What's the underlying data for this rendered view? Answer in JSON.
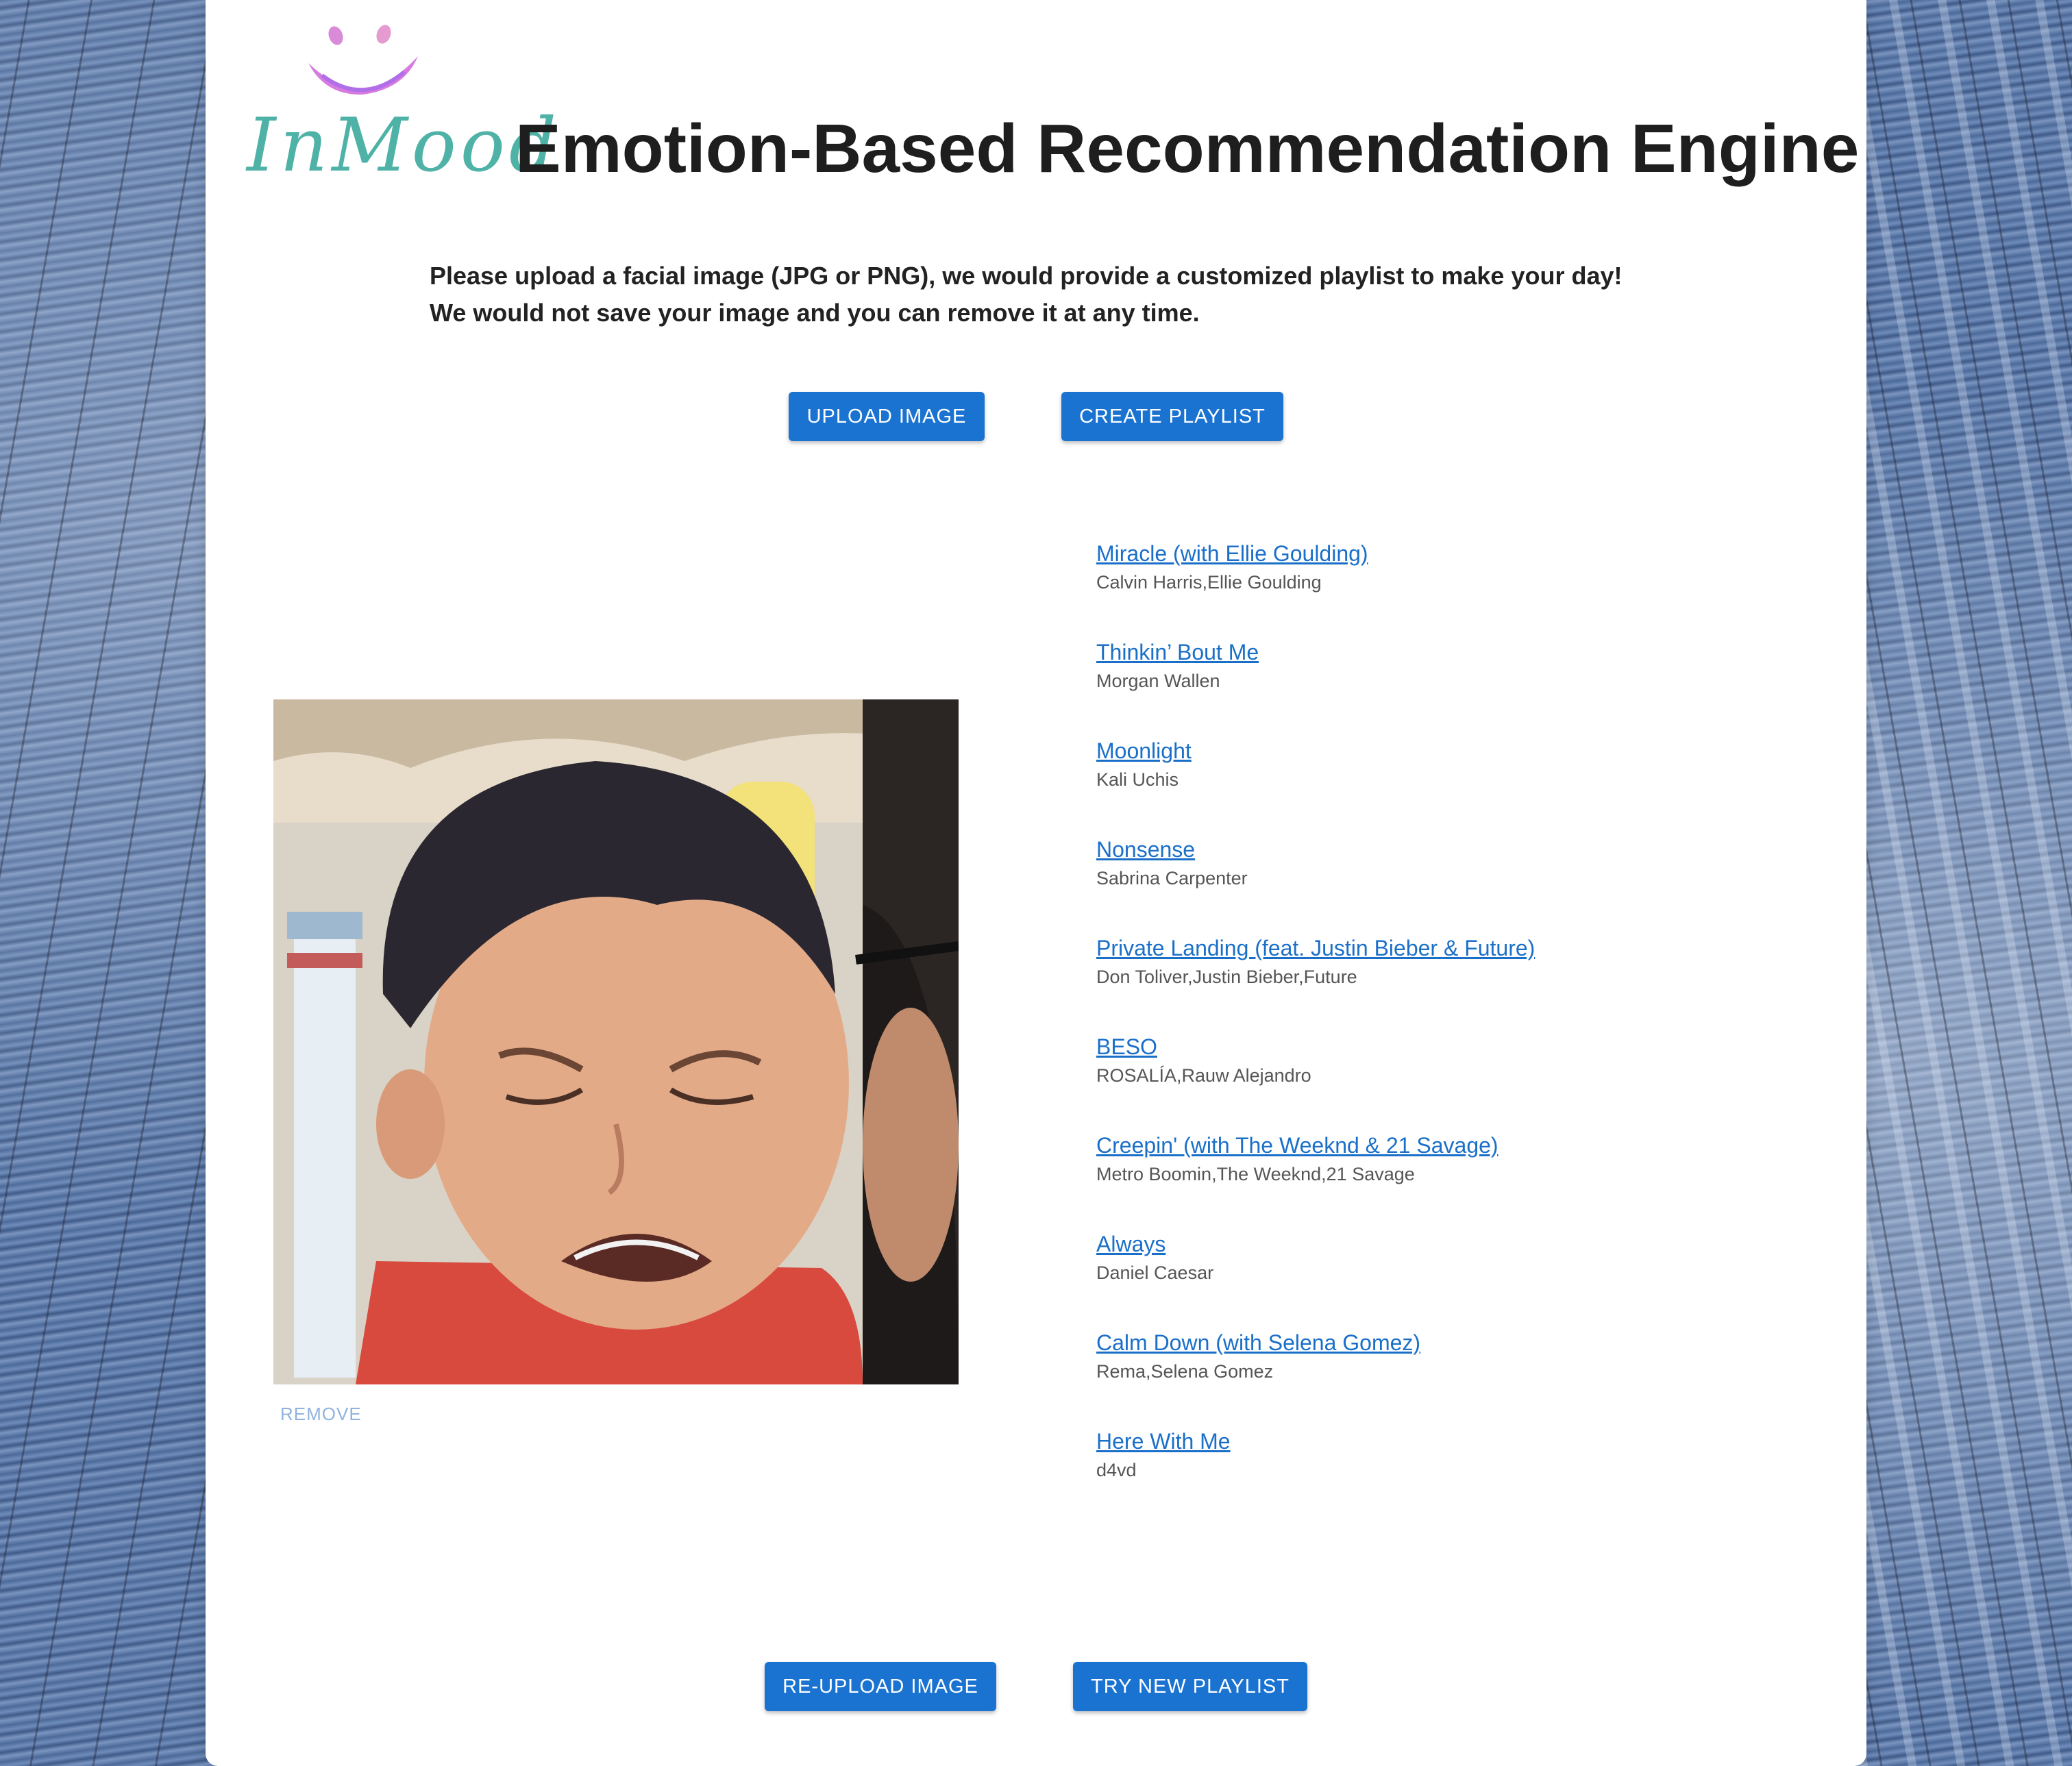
{
  "header": {
    "logo_text": "InMood",
    "title": "Emotion-Based Recommendation Engine"
  },
  "intro": {
    "line1": "Please upload a facial image (JPG or PNG), we would provide a customized playlist to make your day!",
    "line2": "We would not save your image and you can remove it at any time."
  },
  "buttons": {
    "upload": "UPLOAD IMAGE",
    "create": "CREATE PLAYLIST",
    "reupload": "RE-UPLOAD IMAGE",
    "try_new": "TRY NEW PLAYLIST"
  },
  "image_panel": {
    "remove_label": "REMOVE"
  },
  "playlist": [
    {
      "title": "Miracle (with Ellie Goulding)",
      "artist": "Calvin Harris,Ellie Goulding"
    },
    {
      "title": "Thinkin’ Bout Me",
      "artist": "Morgan Wallen"
    },
    {
      "title": "Moonlight",
      "artist": "Kali Uchis"
    },
    {
      "title": "Nonsense",
      "artist": "Sabrina Carpenter"
    },
    {
      "title": "Private Landing (feat. Justin Bieber & Future)",
      "artist": "Don Toliver,Justin Bieber,Future"
    },
    {
      "title": "BESO",
      "artist": "ROSALÍA,Rauw Alejandro"
    },
    {
      "title": "Creepin' (with The Weeknd & 21 Savage)",
      "artist": "Metro Boomin,The Weeknd,21 Savage"
    },
    {
      "title": "Always",
      "artist": "Daniel Caesar"
    },
    {
      "title": "Calm Down (with Selena Gomez)",
      "artist": "Rema,Selena Gomez"
    },
    {
      "title": "Here With Me",
      "artist": "d4vd"
    }
  ],
  "colors": {
    "button": "#1a73d1",
    "link": "#1a6fc9",
    "logo_teal": "#4fb2a6",
    "logo_pink": "#e07fd6"
  }
}
